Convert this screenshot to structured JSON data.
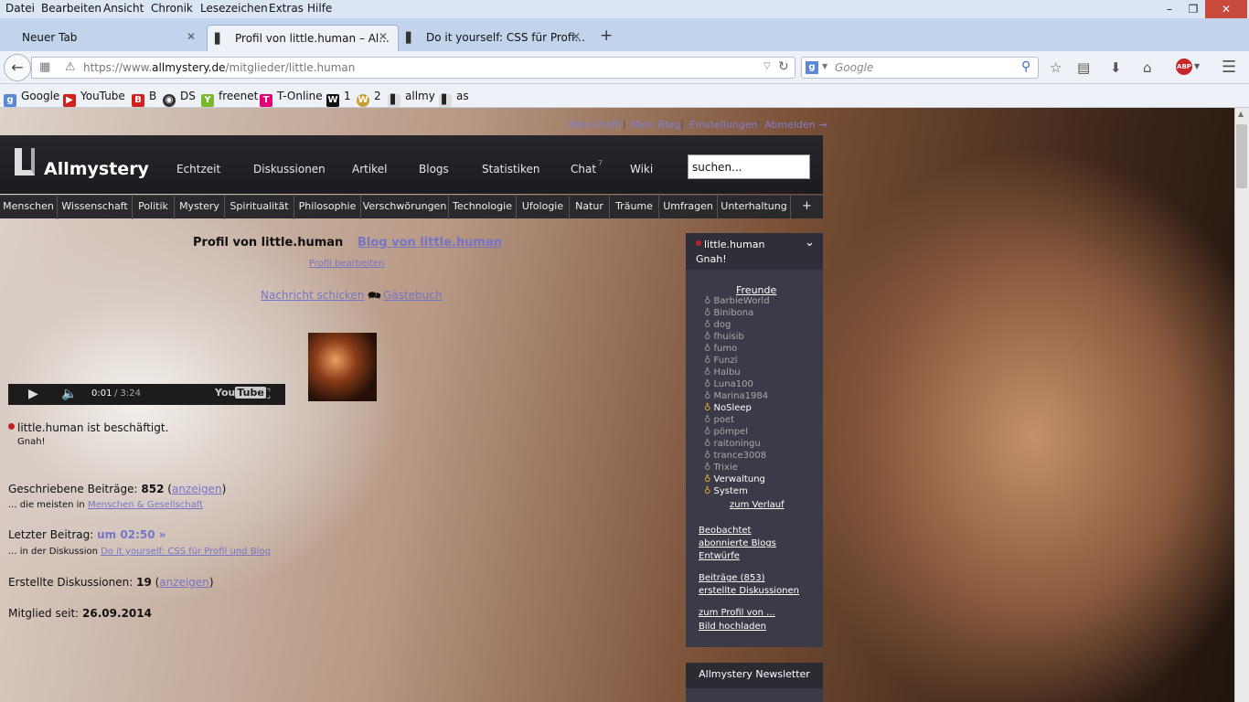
{
  "menubar": {
    "items": [
      "Datei",
      "Bearbeiten",
      "Ansicht",
      "Chronik",
      "Lesezeichen",
      "Extras",
      "Hilfe"
    ]
  },
  "tabs": [
    {
      "label": "Neuer Tab"
    },
    {
      "label": "Profil von little.human – Al..."
    },
    {
      "label": "Do it yourself: CSS für Profi..."
    }
  ],
  "navbar": {
    "url_prefix": "https://www.",
    "url_domain": "allmystery.de",
    "url_path": "/mitglieder/little.human",
    "search_placeholder": "Google"
  },
  "bookmarks": [
    "Google",
    "YouTube",
    "B",
    "DS",
    "freenet",
    "T-Online",
    "1",
    "2",
    "allmy",
    "as"
  ],
  "site": {
    "toplinks": [
      "Mein Profil",
      "Mein Blog",
      "Einstellungen",
      "Abmelden →"
    ],
    "logo": "Allmystery",
    "mainnav": [
      "Echtzeit",
      "Diskussionen",
      "Artikel",
      "Blogs",
      "Statistiken",
      "Chat",
      "Wiki"
    ],
    "chat_badge": "7",
    "search_value": "suchen...",
    "categories": [
      "Menschen",
      "Wissenschaft",
      "Politik",
      "Mystery",
      "Spiritualität",
      "Philosophie",
      "Verschwörungen",
      "Technologie",
      "Ufologie",
      "Natur",
      "Träume",
      "Umfragen",
      "Unterhaltung",
      "+"
    ]
  },
  "profile": {
    "title": "Profil von little.human",
    "blog_link": "Blog von little.human",
    "edit_link": "Profil bearbeiten",
    "message_link": "Nachricht schicken",
    "guestbook_link": "Gästebuch",
    "video_time": "0:01",
    "video_duration": "/ 3:24",
    "status": "little.human ist beschäftigt.",
    "status_note": "Gnah!",
    "posts_label": "Geschriebene Beiträge:",
    "posts_count": "852",
    "show_link": "anzeigen",
    "posts_sub_prefix": "... die meisten in",
    "posts_sub_link": "Menschen & Gesellschaft",
    "last_post_label": "Letzter Beitrag:",
    "last_post_value": "um 02:50 »",
    "last_post_sub_prefix": "... in der Diskussion",
    "last_post_sub_link": "Do it yourself: CSS für Profil und Blog",
    "discussions_label": "Erstellte Diskussionen:",
    "discussions_count": "19",
    "member_since_label": "Mitglied seit:",
    "member_since_value": "26.09.2014"
  },
  "sidebar": {
    "username": "little.human",
    "status": "Gnah!",
    "friends_heading": "Freunde",
    "friends": [
      {
        "name": "BarbieWorld",
        "online": false
      },
      {
        "name": "Binibona",
        "online": false
      },
      {
        "name": "dog",
        "online": false
      },
      {
        "name": "fhuisib",
        "online": false
      },
      {
        "name": "fumo",
        "online": false
      },
      {
        "name": "Funzl",
        "online": false
      },
      {
        "name": "Halbu",
        "online": false
      },
      {
        "name": "Luna100",
        "online": false
      },
      {
        "name": "Marina1984",
        "online": false
      },
      {
        "name": "NoSleep",
        "online": true
      },
      {
        "name": "poet",
        "online": false
      },
      {
        "name": "pömpel",
        "online": false
      },
      {
        "name": "raitoningu",
        "online": false
      },
      {
        "name": "trance3008",
        "online": false
      },
      {
        "name": "Trixie",
        "online": false
      },
      {
        "name": "Verwaltung",
        "online": true
      },
      {
        "name": "System",
        "online": true
      }
    ],
    "history_link": "zum Verlauf",
    "links_group1": [
      "Beobachtet",
      "abonnierte Blogs",
      "Entwürfe"
    ],
    "links_group2": [
      "Beiträge (853)",
      "erstellte Diskussionen"
    ],
    "links_group3": [
      "zum Profil von ...",
      "Bild hochladen"
    ],
    "newsletter": "Allmystery Newsletter"
  },
  "colors": {
    "link": "#7575c8",
    "header_bg": "#1b1b20",
    "sidebar_bg": "#3b3b47",
    "busy_status": "#c02020"
  }
}
